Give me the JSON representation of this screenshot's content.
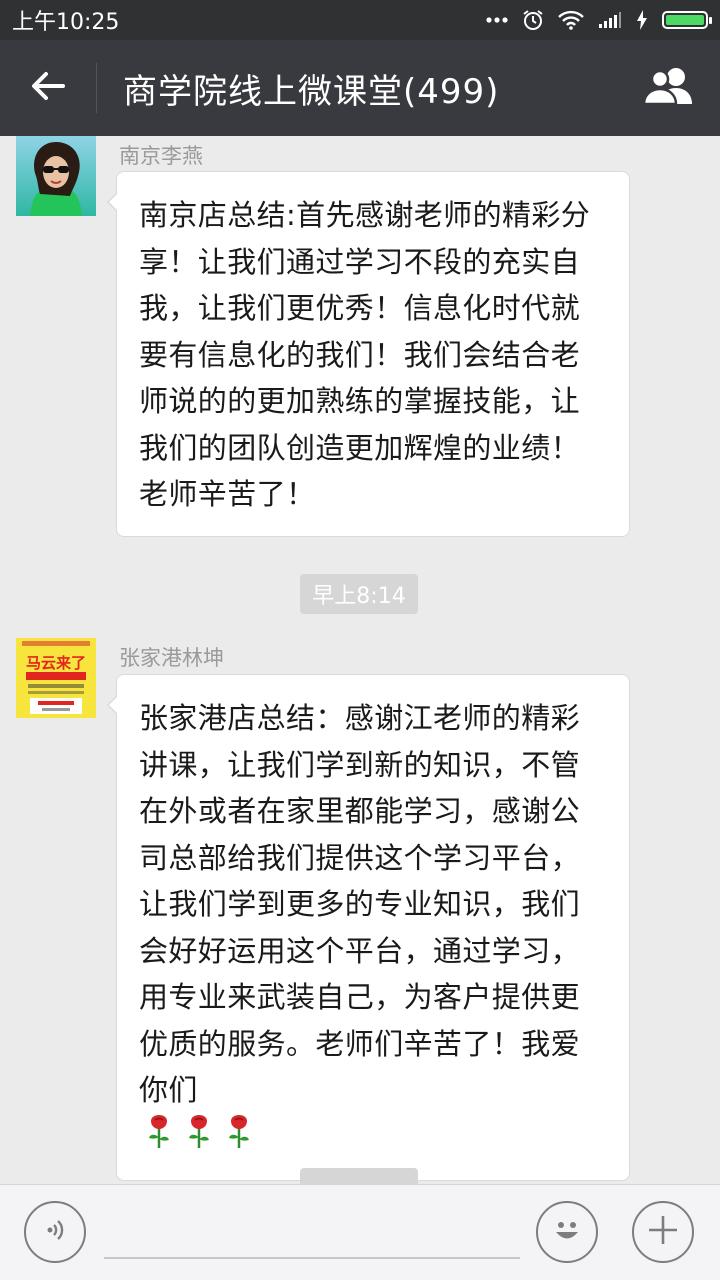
{
  "status_bar": {
    "time": "上午10:25",
    "icons": [
      "more-dots-icon",
      "alarm-icon",
      "wifi-icon",
      "signal-icon",
      "charging-icon",
      "battery-icon"
    ]
  },
  "header": {
    "title": "商学院线上微课堂(499)",
    "back_icon": "back-arrow-icon",
    "members_icon": "group-members-icon"
  },
  "messages": [
    {
      "sender": "南京李燕",
      "text": "南京店总结:首先感谢老师的精彩分享！让我们通过学习不段的充实自我，让我们更优秀！信息化时代就要有信息化的我们！我们会结合老师说的的更加熟练的掌握技能，让我们的团队创造更加辉煌的业绩！老师辛苦了！",
      "avatar": "woman-sunglasses-avatar"
    },
    {
      "timestamp": "早上8:14"
    },
    {
      "sender": "张家港林坤",
      "text": "张家港店总结：感谢江老师的精彩讲课，让我们学到新的知识，不管在外或者在家里都能学习，感谢公司总部给我们提供这个学习平台，让我们学到更多的专业知识，我们会好好运用这个平台，通过学习，用专业来武装自己，为客户提供更优质的服务。老师们辛苦了！我爱你们",
      "emoji": [
        "rose-icon",
        "rose-icon",
        "rose-icon"
      ],
      "avatar": "promo-poster-avatar",
      "avatar_text": "马云来了"
    }
  ],
  "input_bar": {
    "voice_icon": "voice-icon",
    "emoji_icon": "emoji-icon",
    "plus_icon": "plus-icon",
    "placeholder": ""
  },
  "colors": {
    "status_bar_bg": "#2f3133",
    "title_bar_bg": "#393a3f",
    "chat_bg": "#ebebeb",
    "bubble_bg": "#ffffff",
    "battery_green": "#4cd964"
  }
}
